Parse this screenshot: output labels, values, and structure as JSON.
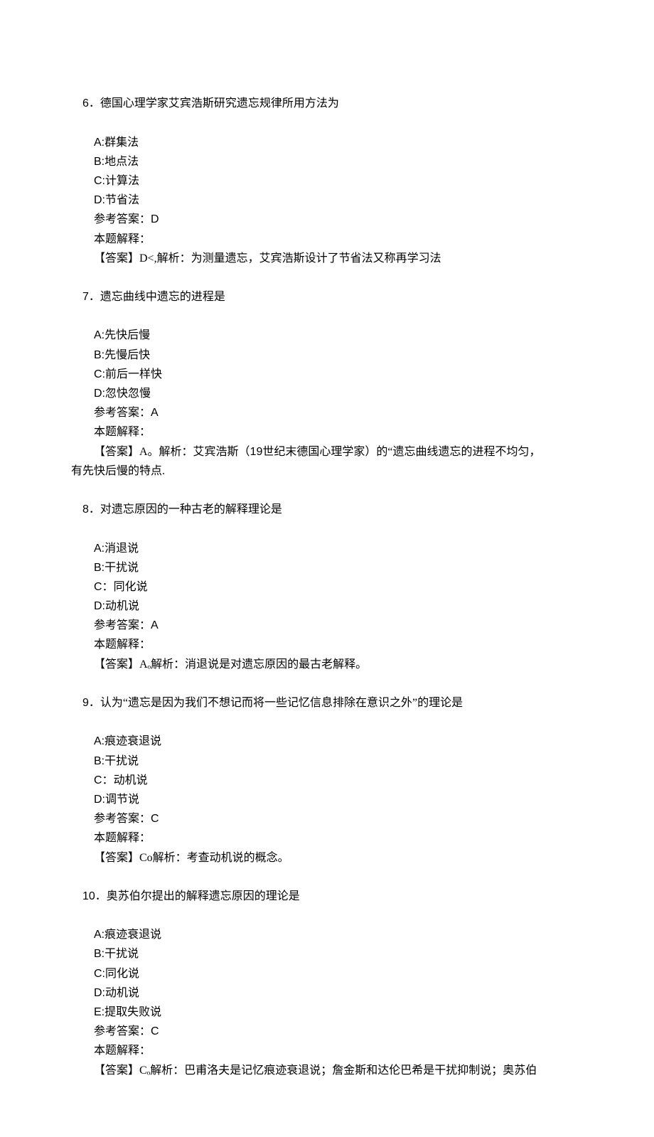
{
  "questions": [
    {
      "number": "6",
      "stem": "．德国心理学家艾宾浩斯研究遗忘规律所用方法为",
      "options": [
        {
          "label": "A:",
          "text": "群集法"
        },
        {
          "label": "B:",
          "text": "地点法"
        },
        {
          "label": "C:",
          "text": "计算法"
        },
        {
          "label": "D:",
          "text": "节省法"
        }
      ],
      "answer_label": "参考答案：",
      "answer_value": "D",
      "explain_label": "本题解释：",
      "explain_text": "【答案】D<,解析：为测量遗忘，艾宾浩斯设计了节省法又称再学习法"
    },
    {
      "number": "7",
      "stem": "．遗忘曲线中遗忘的进程是",
      "options": [
        {
          "label": "A:",
          "text": "先快后慢"
        },
        {
          "label": "B:",
          "text": "先慢后快"
        },
        {
          "label": "C:",
          "text": "前后一样快"
        },
        {
          "label": "D:",
          "text": "忽快忽慢"
        }
      ],
      "answer_label": "参考答案：",
      "answer_value": "A",
      "explain_label": "本题解释：",
      "explain_text_prefix": "【答案】A。解析：艾宾浩斯（",
      "explain_text_mid": "19",
      "explain_text_suffix": "世纪末德国心理学家）的“遗忘曲线遗忘的进程不均匀，",
      "explain_text_line2": "有先快后慢的特点."
    },
    {
      "number": "8",
      "stem": "．对遗忘原因的一种古老的解释理论是",
      "options": [
        {
          "label": "A:",
          "text": "消退说"
        },
        {
          "label": "B:",
          "text": "干扰说"
        },
        {
          "label": "C：",
          "text": "同化说"
        },
        {
          "label": "D:",
          "text": "动机说"
        }
      ],
      "answer_label": "参考答案：",
      "answer_value": "A",
      "explain_label": "本题解释：",
      "explain_text": "【答案】Aₒ解析：消退说是对遗忘原因的最古老解释。"
    },
    {
      "number": "9",
      "stem": "．认为“遗忘是因为我们不想记而将一些记忆信息排除在意识之外”的理论是",
      "options": [
        {
          "label": "A:",
          "text": "痕迹衰退说"
        },
        {
          "label": "B:",
          "text": "干扰说"
        },
        {
          "label": "C：",
          "text": "动机说"
        },
        {
          "label": "D:",
          "text": "调节说"
        }
      ],
      "answer_label": "参考答案：",
      "answer_value": "C",
      "explain_label": "本题解释：",
      "explain_text": "【答案】Co解析：考查动机说的概念。"
    },
    {
      "number": "10",
      "stem": "．奥苏伯尔提出的解释遗忘原因的理论是",
      "options": [
        {
          "label": "A:",
          "text": "痕迹衰退说"
        },
        {
          "label": "B:",
          "text": "干扰说"
        },
        {
          "label": "C:",
          "text": "同化说"
        },
        {
          "label": "D:",
          "text": "动机说"
        },
        {
          "label": "E:",
          "text": "提取失败说"
        }
      ],
      "answer_label": "参考答案：",
      "answer_value": "C",
      "explain_label": "本题解释：",
      "explain_text": "【答案】Cₒ解析：巴甫洛夫是记忆痕迹衰退说；詹金斯和达伦巴希是干扰抑制说；奥苏伯"
    }
  ]
}
